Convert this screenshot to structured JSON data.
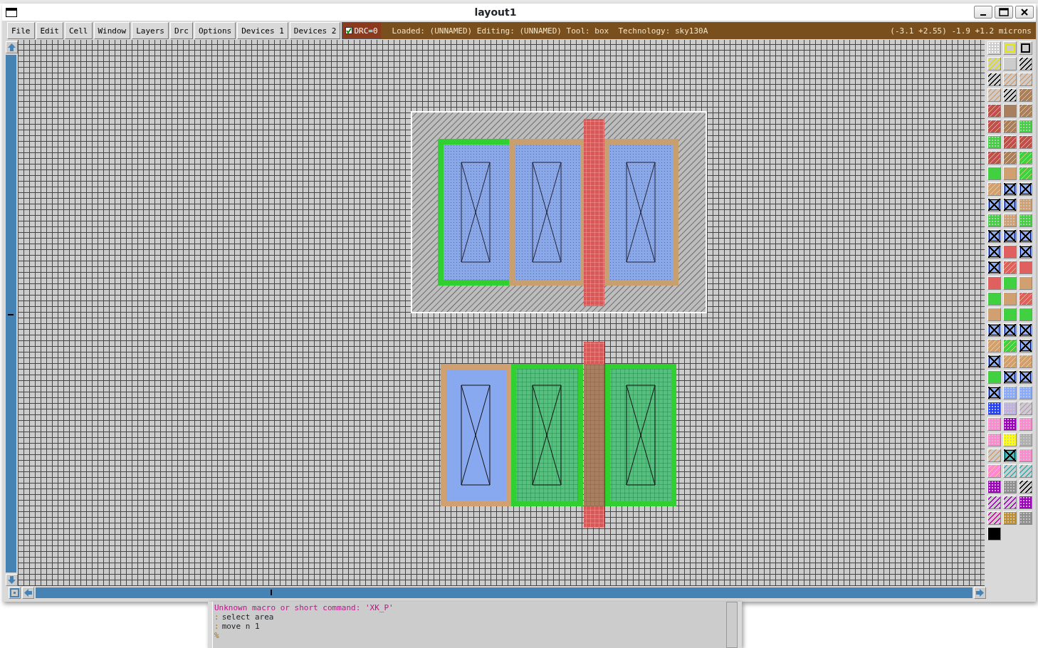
{
  "window": {
    "title": "layout1"
  },
  "menu": [
    "File",
    "Edit",
    "Cell",
    "Window",
    "Layers",
    "Drc",
    "Options",
    "Devices 1",
    "Devices 2"
  ],
  "drc_toggle": {
    "label": "DRC=0",
    "checked": true
  },
  "status": {
    "info": "Loaded: (UNNAMED) Editing: (UNNAMED) Tool: box  Technology: sky130A",
    "coords": "(-3.1 +2.55) -1.9 +1.2 microns"
  },
  "palette": [
    {
      "kind": "grid",
      "color": "#ffffff"
    },
    {
      "kind": "outline",
      "color": "#e8e800"
    },
    {
      "kind": "outline",
      "color": "#000000"
    },
    {
      "kind": "hatch",
      "color": "#e0e000"
    },
    {
      "kind": "solid",
      "color": "#cccccc"
    },
    {
      "kind": "hatch",
      "color": "#000000"
    },
    {
      "kind": "hatch",
      "color": "#000000"
    },
    {
      "kind": "hatch",
      "color": "#d8a070"
    },
    {
      "kind": "hatch",
      "color": "#d8a070"
    },
    {
      "kind": "hatch",
      "color": "#d8a070"
    },
    {
      "kind": "hatch",
      "color": "#000000"
    },
    {
      "kind": "fillhatch",
      "color": "#a88060"
    },
    {
      "kind": "fillhatch",
      "color": "#c05050"
    },
    {
      "kind": "solid",
      "color": "#a88060"
    },
    {
      "kind": "fillhatch",
      "color": "#a88060"
    },
    {
      "kind": "fillhatch",
      "color": "#c05050"
    },
    {
      "kind": "fillhatch",
      "color": "#a88060"
    },
    {
      "kind": "dots",
      "color": "#40d040"
    },
    {
      "kind": "dots",
      "color": "#40d040"
    },
    {
      "kind": "fillhatch",
      "color": "#c05050"
    },
    {
      "kind": "fillhatch",
      "color": "#c05050"
    },
    {
      "kind": "fillhatch",
      "color": "#c05050"
    },
    {
      "kind": "fillhatch",
      "color": "#a88060"
    },
    {
      "kind": "fillhatch",
      "color": "#40d040"
    },
    {
      "kind": "solid",
      "color": "#40d040"
    },
    {
      "kind": "solid",
      "color": "#d0a070"
    },
    {
      "kind": "fillhatch",
      "color": "#40d040"
    },
    {
      "kind": "fillhatch",
      "color": "#d0a070"
    },
    {
      "kind": "contact",
      "color": "#88aaff"
    },
    {
      "kind": "contact",
      "color": "#88aaff"
    },
    {
      "kind": "contact",
      "color": "#88aaff"
    },
    {
      "kind": "contact",
      "color": "#88aaff"
    },
    {
      "kind": "dots",
      "color": "#d0a070"
    },
    {
      "kind": "dots",
      "color": "#40d040"
    },
    {
      "kind": "dots",
      "color": "#d0a070"
    },
    {
      "kind": "dots",
      "color": "#40d040"
    },
    {
      "kind": "contact",
      "color": "#88aaff"
    },
    {
      "kind": "contact",
      "color": "#88aaff"
    },
    {
      "kind": "contact",
      "color": "#88aaff"
    },
    {
      "kind": "contact",
      "color": "#88aaff"
    },
    {
      "kind": "solid",
      "color": "#e06060"
    },
    {
      "kind": "contact",
      "color": "#88aaff"
    },
    {
      "kind": "contact",
      "color": "#88aaff"
    },
    {
      "kind": "fillhatch",
      "color": "#e06060"
    },
    {
      "kind": "solid",
      "color": "#e06060"
    },
    {
      "kind": "solid",
      "color": "#e06060"
    },
    {
      "kind": "solid",
      "color": "#40d040"
    },
    {
      "kind": "solid",
      "color": "#d0a070"
    },
    {
      "kind": "solid",
      "color": "#40d040"
    },
    {
      "kind": "solid",
      "color": "#d0a070"
    },
    {
      "kind": "fillhatch",
      "color": "#e06060"
    },
    {
      "kind": "solid",
      "color": "#d0a070"
    },
    {
      "kind": "solid",
      "color": "#40d040"
    },
    {
      "kind": "solid",
      "color": "#40d040"
    },
    {
      "kind": "contact",
      "color": "#88aaff"
    },
    {
      "kind": "contact",
      "color": "#88aaff"
    },
    {
      "kind": "contact",
      "color": "#88aaff"
    },
    {
      "kind": "fillhatch",
      "color": "#d0a070"
    },
    {
      "kind": "fillhatch",
      "color": "#40d040"
    },
    {
      "kind": "contact",
      "color": "#88aaff"
    },
    {
      "kind": "contact",
      "color": "#88aaff"
    },
    {
      "kind": "fillhatch",
      "color": "#d0a070"
    },
    {
      "kind": "fillhatch",
      "color": "#d0a070"
    },
    {
      "kind": "solid",
      "color": "#40d040"
    },
    {
      "kind": "contact",
      "color": "#88aaff"
    },
    {
      "kind": "contact",
      "color": "#88aaff"
    },
    {
      "kind": "contact",
      "color": "#88aaff"
    },
    {
      "kind": "dots",
      "color": "#88aaff"
    },
    {
      "kind": "dots",
      "color": "#88aaff"
    },
    {
      "kind": "dots",
      "color": "#2040ff"
    },
    {
      "kind": "dots",
      "color": "#c0b0e0"
    },
    {
      "kind": "hatch",
      "color": "#c0a0c0"
    },
    {
      "kind": "dots",
      "color": "#ff88d0"
    },
    {
      "kind": "dots",
      "color": "#a000c0"
    },
    {
      "kind": "dots",
      "color": "#ff88d0"
    },
    {
      "kind": "dots",
      "color": "#ff88d0"
    },
    {
      "kind": "dots",
      "color": "#ffff00"
    },
    {
      "kind": "dots",
      "color": "#b0b0b0"
    },
    {
      "kind": "hatch",
      "color": "#d0a070"
    },
    {
      "kind": "contact",
      "color": "#40c0c0"
    },
    {
      "kind": "dots",
      "color": "#ff88d0"
    },
    {
      "kind": "fillhatch",
      "color": "#ff88d0"
    },
    {
      "kind": "hatch",
      "color": "#30b0b0"
    },
    {
      "kind": "hatch",
      "color": "#30b0b0"
    },
    {
      "kind": "dots",
      "color": "#a000c0"
    },
    {
      "kind": "dots",
      "color": "#909090"
    },
    {
      "kind": "hatch",
      "color": "#000000"
    },
    {
      "kind": "hatch",
      "color": "#a000c0"
    },
    {
      "kind": "hatch",
      "color": "#a000c0"
    },
    {
      "kind": "dots",
      "color": "#a000c0"
    },
    {
      "kind": "hatch",
      "color": "#e000a0"
    },
    {
      "kind": "dots",
      "color": "#c09030"
    },
    {
      "kind": "dots",
      "color": "#909090"
    },
    {
      "kind": "solid",
      "color": "#000000"
    }
  ],
  "console": {
    "lines": [
      {
        "kind": "error",
        "text": "Unknown macro or short command: 'XK_P'"
      },
      {
        "kind": "command",
        "prompt": ":",
        "text": "select area"
      },
      {
        "kind": "command",
        "prompt": ":",
        "text": "move n 1"
      },
      {
        "kind": "prompt",
        "prompt": "%"
      }
    ]
  }
}
